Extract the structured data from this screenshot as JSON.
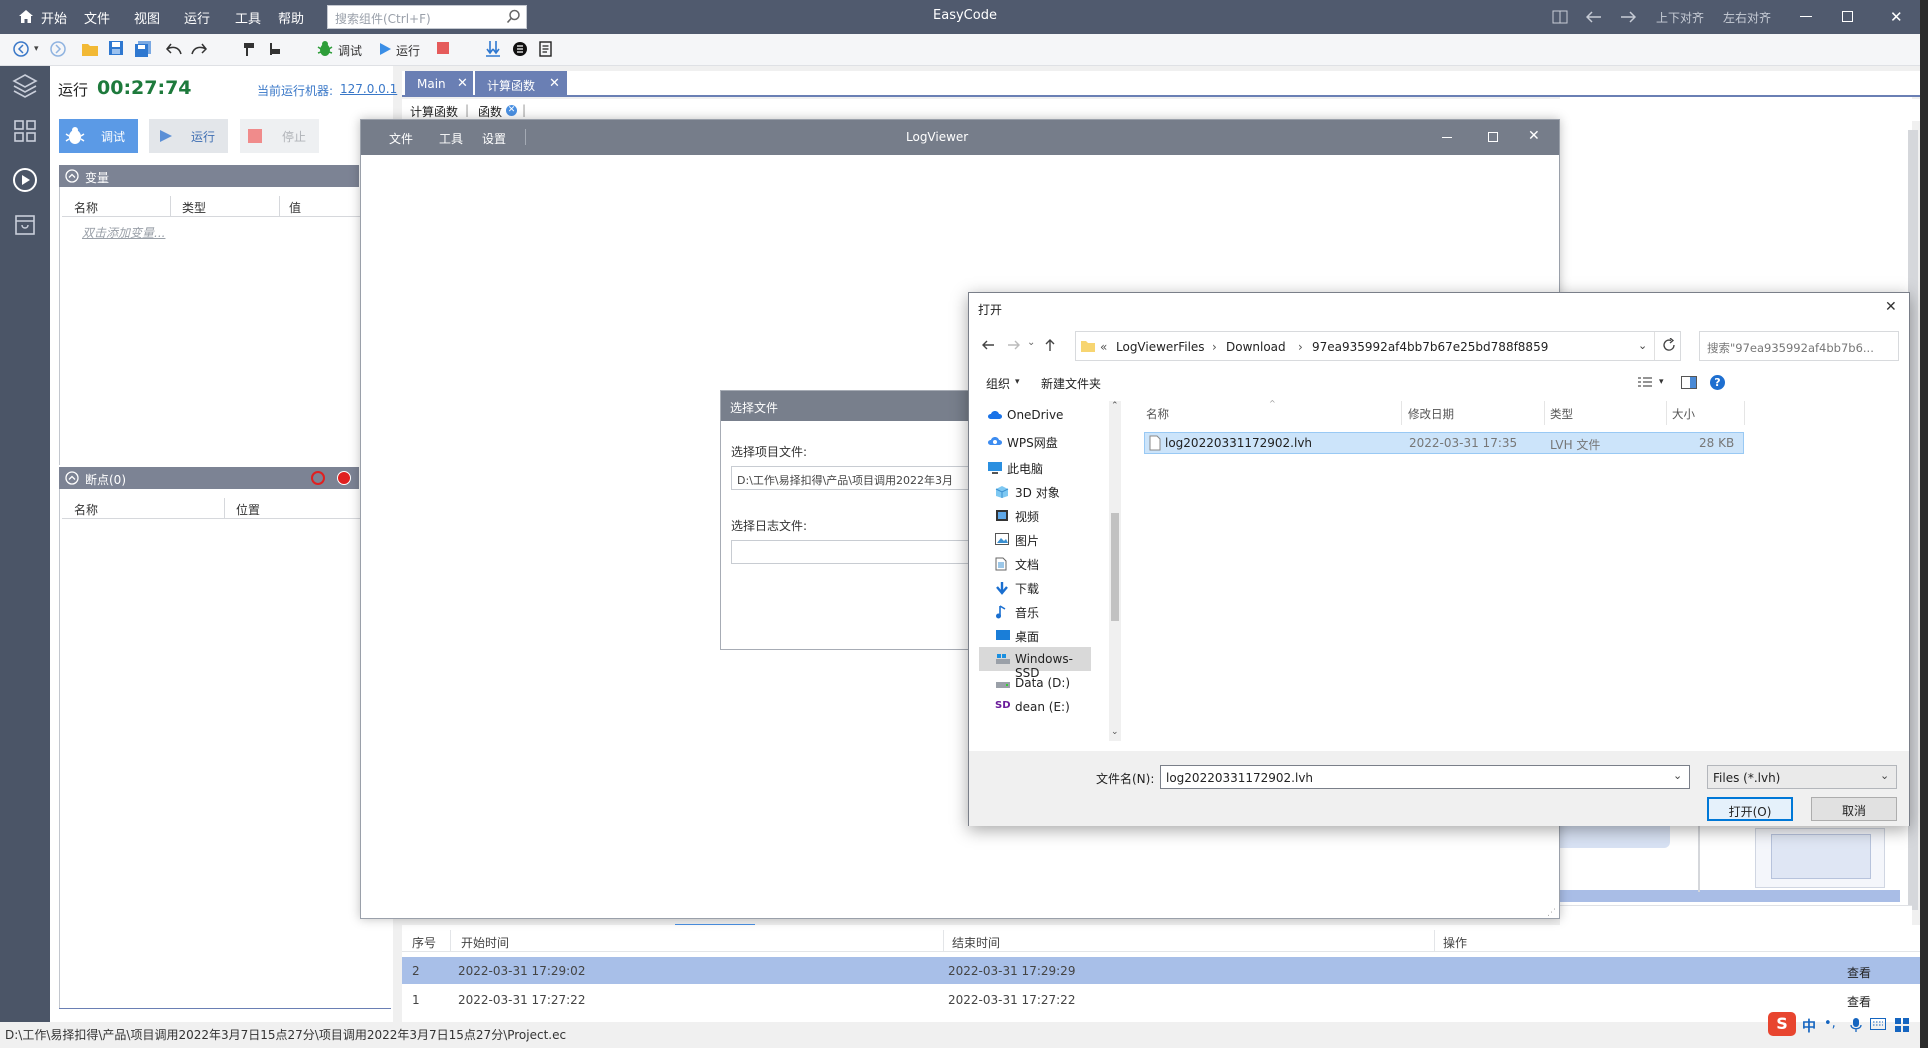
{
  "app": {
    "title": "EasyCode",
    "menus": [
      "开始",
      "文件",
      "视图",
      "运行",
      "工具",
      "帮助"
    ],
    "search_placeholder": "搜索组件(Ctrl+F)",
    "align_vertical": "上下对齐",
    "align_horizontal": "左右对齐"
  },
  "toolbar": {
    "debug_label": "调试",
    "run_label": "运行"
  },
  "left_panel": {
    "run_label": "运行",
    "run_time": "00:27:74",
    "machine_label": "当前运行机器:",
    "machine_ip": "127.0.0.1",
    "btn_debug": "调试",
    "btn_run": "运行",
    "btn_stop": "停止",
    "variables": {
      "title": "变量",
      "col_name": "名称",
      "col_type": "类型",
      "col_value": "值",
      "hint": "双击添加变量..."
    },
    "breakpoints": {
      "title": "断点(0)",
      "col_name": "名称",
      "col_position": "位置"
    }
  },
  "editor": {
    "tabs": [
      {
        "label": "Main"
      },
      {
        "label": "计算函数"
      }
    ],
    "subtabs": [
      "计算函数",
      "函数"
    ]
  },
  "bottom_table": {
    "headers": [
      "序号",
      "开始时间",
      "结束时间",
      "操作"
    ],
    "rows": [
      {
        "index": "2",
        "start": "2022-03-31 17:29:02",
        "end": "2022-03-31 17:29:29",
        "action": "查看"
      },
      {
        "index": "1",
        "start": "2022-03-31 17:27:22",
        "end": "2022-03-31 17:27:22",
        "action": "查看"
      }
    ]
  },
  "statusbar": {
    "path": "D:\\工作\\易择扣得\\产品\\项目调用2022年3月7日15点27分\\项目调用2022年3月7日15点27分\\Project.ec"
  },
  "logviewer": {
    "title": "LogViewer",
    "menus": [
      "文件",
      "工具",
      "设置"
    ]
  },
  "select_file": {
    "title": "选择文件",
    "project_label": "选择项目文件:",
    "project_value": "D:\\工作\\易择扣得\\产品\\项目调用2022年3月",
    "log_label": "选择日志文件:",
    "log_value": ""
  },
  "open_dialog": {
    "title": "打开",
    "breadcrumbs": [
      "«",
      "LogViewerFiles",
      "Download",
      "97ea935992af4bb7b67e25bd788f8859"
    ],
    "search_placeholder": "搜索\"97ea935992af4bb7b6...",
    "organize": "组织",
    "new_folder": "新建文件夹",
    "nav": [
      {
        "label": "OneDrive",
        "icon": "cloud-icon"
      },
      {
        "label": "WPS网盘",
        "icon": "wps-cloud-icon"
      },
      {
        "label": "此电脑",
        "icon": "computer-icon"
      },
      {
        "label": "3D 对象",
        "icon": "cube-icon"
      },
      {
        "label": "视频",
        "icon": "video-icon"
      },
      {
        "label": "图片",
        "icon": "picture-icon"
      },
      {
        "label": "文档",
        "icon": "document-icon"
      },
      {
        "label": "下载",
        "icon": "download-icon"
      },
      {
        "label": "音乐",
        "icon": "music-icon"
      },
      {
        "label": "桌面",
        "icon": "desktop-icon"
      },
      {
        "label": "Windows-SSD",
        "icon": "drive-icon"
      },
      {
        "label": "Data (D:)",
        "icon": "drive-icon"
      },
      {
        "label": "dean (E:)",
        "icon": "sd-card-icon"
      }
    ],
    "columns": [
      "名称",
      "修改日期",
      "类型",
      "大小"
    ],
    "files": [
      {
        "name": "log20220331172902.lvh",
        "date": "2022-03-31 17:35",
        "type": "LVH 文件",
        "size": "28 KB"
      }
    ],
    "filename_label": "文件名(N):",
    "filename_value": "log20220331172902.lvh",
    "filetype": "Files (*.lvh)",
    "open_button": "打开(O)",
    "cancel_button": "取消"
  },
  "colors": {
    "topbar": "#505a6e",
    "accent": "#5b9ae6",
    "run_time": "#1e7a3c",
    "selection": "#cce4fa"
  }
}
